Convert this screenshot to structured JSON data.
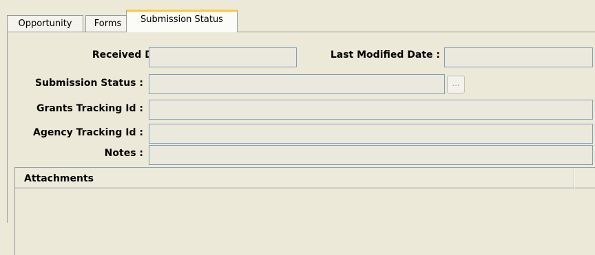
{
  "tabs": {
    "opportunity": "Opportunity",
    "forms": "Forms",
    "submission_status": "Submission Status"
  },
  "fields": {
    "received_date": {
      "label": "Received Date :",
      "value": ""
    },
    "last_modified_date": {
      "label": "Last Modified Date :",
      "value": ""
    },
    "submission_status": {
      "label": "Submission Status :",
      "value": ""
    },
    "grants_tracking_id": {
      "label": "Grants Tracking Id :",
      "value": ""
    },
    "agency_tracking_id": {
      "label": "Agency Tracking Id :",
      "value": ""
    },
    "notes": {
      "label": "Notes :",
      "value": ""
    }
  },
  "ellipsis_button": {
    "label": "..."
  },
  "attachments": {
    "title": "Attachments"
  },
  "colors": {
    "window_background": "#ece9d8",
    "active_tab_accent": "#ffc83c",
    "field_border": "#7f9db9",
    "field_background": "#ebe9dd"
  }
}
